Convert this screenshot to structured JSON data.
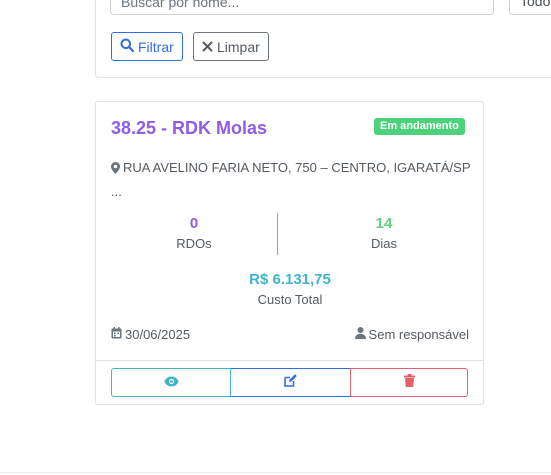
{
  "filters": {
    "search_placeholder": "Buscar por nome...",
    "status_value": "Todo",
    "filter_label": "Filtrar",
    "clear_label": "Limpar"
  },
  "obra": {
    "title": "38.25 - RDK Molas",
    "status": "Em andamento",
    "address": "RUA AVELINO FARIA NETO, 750 – CENTRO, IGARATÁ/SP",
    "address_more": "...",
    "rdos_count": "0",
    "rdos_label": "RDOs",
    "days_count": "14",
    "days_label": "Dias",
    "total_cost": "R$ 6.131,75",
    "total_cost_label": "Custo Total",
    "date": "30/06/2025",
    "responsible": "Sem responsável"
  },
  "colors": {
    "primary": "#2f6ee0",
    "purple": "#8e5ce6",
    "success": "#4bd27a",
    "info": "#3fb5c8",
    "danger": "#e4606d"
  },
  "icons": [
    "search-icon",
    "close-icon",
    "map-marker-icon",
    "calendar-icon",
    "user-icon",
    "eye-icon",
    "edit-icon",
    "trash-icon"
  ]
}
